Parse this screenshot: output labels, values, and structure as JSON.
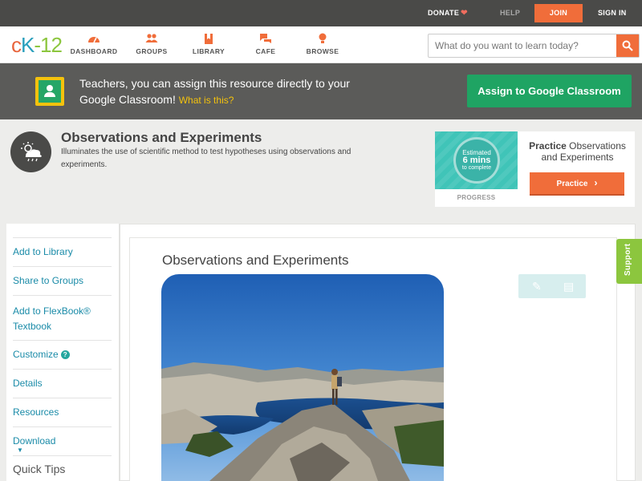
{
  "topbar": {
    "donate": "DONATE",
    "help": "HELP",
    "join": "JOIN",
    "signin": "SIGN IN"
  },
  "nav": {
    "logo_c": "c",
    "logo_k": "K",
    "logo_dash": "-",
    "logo_12": "12",
    "items": [
      {
        "label": "DASHBOARD",
        "icon": "dashboard-icon"
      },
      {
        "label": "GROUPS",
        "icon": "groups-icon"
      },
      {
        "label": "LIBRARY",
        "icon": "library-icon"
      },
      {
        "label": "CAFE",
        "icon": "cafe-icon"
      },
      {
        "label": "BROWSE",
        "icon": "browse-icon"
      }
    ],
    "search_placeholder": "What do you want to learn today?"
  },
  "banner": {
    "text": "Teachers, you can assign this resource directly to your Google Classroom!",
    "what_link": "What is this?",
    "button": "Assign to Google Classroom"
  },
  "header": {
    "title": "Observations and Experiments",
    "description": "Illuminates the use of scientific method to test hypotheses using observations and experiments."
  },
  "practice": {
    "estimate_l1": "Estimated",
    "estimate_l2": "6 mins",
    "estimate_l3": "to complete",
    "progress_label": "PROGRESS",
    "title_bold": "Practice",
    "title_rest": "Observations and Experiments",
    "button": "Practice"
  },
  "sidebar": {
    "items": [
      {
        "label": "Add to Library"
      },
      {
        "label": "Share to Groups"
      },
      {
        "label": "Add to FlexBook® Textbook"
      },
      {
        "label": "Customize"
      },
      {
        "label": "Details"
      },
      {
        "label": "Resources"
      },
      {
        "label": "Download"
      }
    ],
    "quick_tips": "Quick Tips"
  },
  "article": {
    "title": "Observations and Experiments"
  },
  "support": "Support",
  "colors": {
    "accent_orange": "#f06d3a",
    "google_green": "#1fa463",
    "link_teal": "#1a8ba8",
    "support_green": "#8cc63e"
  }
}
